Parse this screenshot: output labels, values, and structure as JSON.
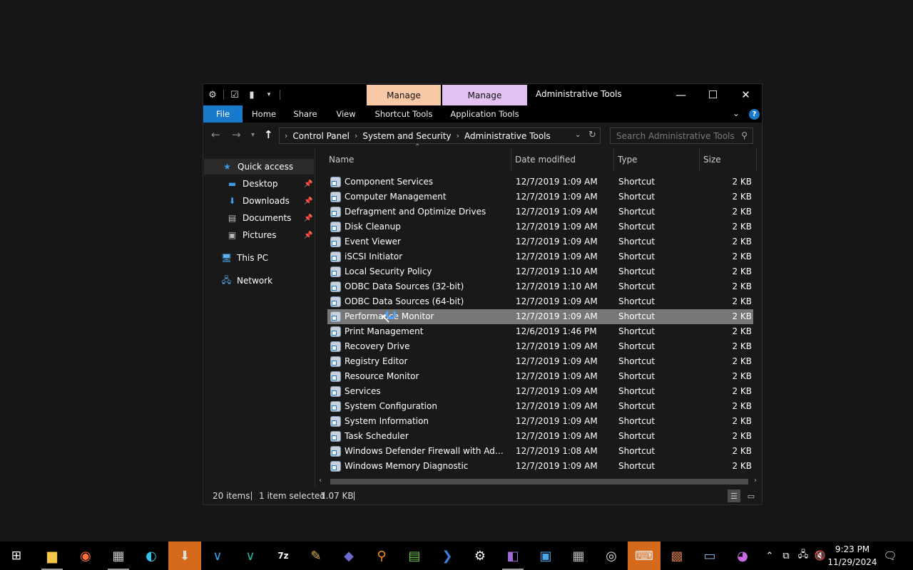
{
  "window": {
    "title": "Administrative Tools",
    "context_tabs": {
      "shortcut_manage": "Manage",
      "app_manage": "Manage"
    },
    "controls": {
      "minimize": "—",
      "maximize": "☐",
      "close": "✕"
    }
  },
  "ribbon": {
    "file": "File",
    "home": "Home",
    "share": "Share",
    "view": "View",
    "shortcut_tools": "Shortcut Tools",
    "application_tools": "Application Tools"
  },
  "address": {
    "crumbs": [
      "Control Panel",
      "System and Security",
      "Administrative Tools"
    ],
    "search_placeholder": "Search Administrative Tools"
  },
  "nav_pane": {
    "quick_access": "Quick access",
    "desktop": "Desktop",
    "downloads": "Downloads",
    "documents": "Documents",
    "pictures": "Pictures",
    "this_pc": "This PC",
    "network": "Network"
  },
  "columns": {
    "name": "Name",
    "date": "Date modified",
    "type": "Type",
    "size": "Size"
  },
  "files": [
    {
      "name": "Component Services",
      "date": "12/7/2019 1:09 AM",
      "type": "Shortcut",
      "size": "2 KB"
    },
    {
      "name": "Computer Management",
      "date": "12/7/2019 1:09 AM",
      "type": "Shortcut",
      "size": "2 KB"
    },
    {
      "name": "Defragment and Optimize Drives",
      "date": "12/7/2019 1:09 AM",
      "type": "Shortcut",
      "size": "2 KB"
    },
    {
      "name": "Disk Cleanup",
      "date": "12/7/2019 1:09 AM",
      "type": "Shortcut",
      "size": "2 KB"
    },
    {
      "name": "Event Viewer",
      "date": "12/7/2019 1:09 AM",
      "type": "Shortcut",
      "size": "2 KB"
    },
    {
      "name": "iSCSI Initiator",
      "date": "12/7/2019 1:09 AM",
      "type": "Shortcut",
      "size": "2 KB"
    },
    {
      "name": "Local Security Policy",
      "date": "12/7/2019 1:10 AM",
      "type": "Shortcut",
      "size": "2 KB"
    },
    {
      "name": "ODBC Data Sources (32-bit)",
      "date": "12/7/2019 1:10 AM",
      "type": "Shortcut",
      "size": "2 KB"
    },
    {
      "name": "ODBC Data Sources (64-bit)",
      "date": "12/7/2019 1:09 AM",
      "type": "Shortcut",
      "size": "2 KB"
    },
    {
      "name": "Performance Monitor",
      "date": "12/7/2019 1:09 AM",
      "type": "Shortcut",
      "size": "2 KB"
    },
    {
      "name": "Print Management",
      "date": "12/6/2019 1:46 PM",
      "type": "Shortcut",
      "size": "2 KB"
    },
    {
      "name": "Recovery Drive",
      "date": "12/7/2019 1:09 AM",
      "type": "Shortcut",
      "size": "2 KB"
    },
    {
      "name": "Registry Editor",
      "date": "12/7/2019 1:09 AM",
      "type": "Shortcut",
      "size": "2 KB"
    },
    {
      "name": "Resource Monitor",
      "date": "12/7/2019 1:09 AM",
      "type": "Shortcut",
      "size": "2 KB"
    },
    {
      "name": "Services",
      "date": "12/7/2019 1:09 AM",
      "type": "Shortcut",
      "size": "2 KB"
    },
    {
      "name": "System Configuration",
      "date": "12/7/2019 1:09 AM",
      "type": "Shortcut",
      "size": "2 KB"
    },
    {
      "name": "System Information",
      "date": "12/7/2019 1:09 AM",
      "type": "Shortcut",
      "size": "2 KB"
    },
    {
      "name": "Task Scheduler",
      "date": "12/7/2019 1:09 AM",
      "type": "Shortcut",
      "size": "2 KB"
    },
    {
      "name": "Windows Defender Firewall with Advanc...",
      "date": "12/7/2019 1:08 AM",
      "type": "Shortcut",
      "size": "2 KB"
    },
    {
      "name": "Windows Memory Diagnostic",
      "date": "12/7/2019 1:09 AM",
      "type": "Shortcut",
      "size": "2 KB"
    }
  ],
  "selected_file": "Performance Monitor",
  "status": {
    "items": "20 items",
    "selection": "1 item selected",
    "size": "1.07 KB"
  },
  "taskbar": {
    "apps": [
      "start-icon",
      "file-explorer-icon",
      "firefox-icon",
      "computer-icon",
      "edge-icon",
      "installer-icon",
      "visual-studio-code-icon",
      "visual-studio-code-insiders-icon",
      "seven-zip-icon",
      "notepad-plus-plus-icon",
      "sublime-icon",
      "search-everything-icon",
      "notepad-icon",
      "powershell-icon",
      "settings-icon",
      "visual-studio-icon",
      "remote-desktop-icon",
      "tools-icon",
      "compass-icon",
      "keyboard-icon",
      "package-icon",
      "monitor-icon",
      "game-icon"
    ],
    "time": "9:23 PM",
    "date": "11/29/2024"
  },
  "colors": {
    "accent": "#1979ca",
    "active_taskbar": "#d66a1c",
    "shortcut_tab": "#f8c8a7",
    "app_tab": "#e3c2f3",
    "selection": "#777777"
  }
}
